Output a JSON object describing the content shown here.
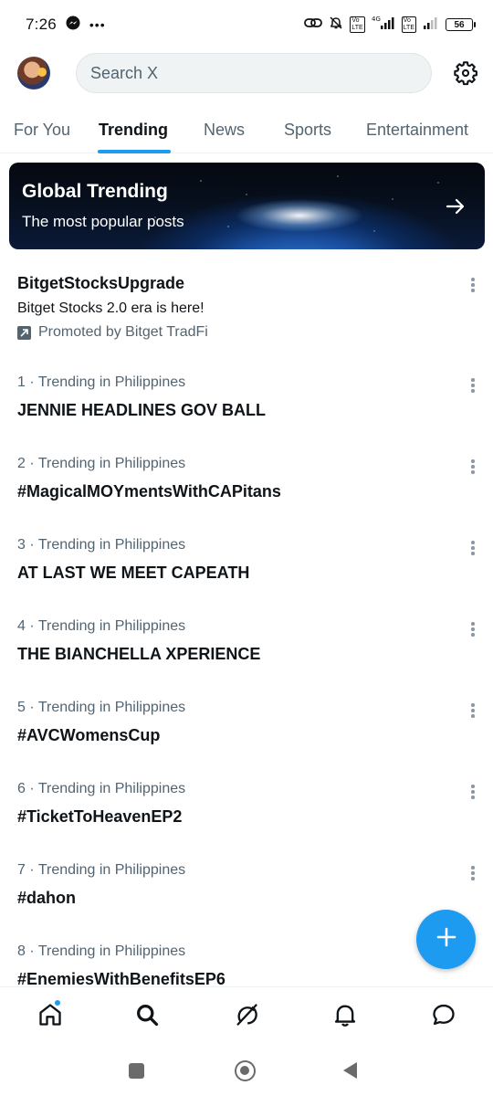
{
  "status_bar": {
    "time": "7:26",
    "battery": "56",
    "network": "4G"
  },
  "search": {
    "placeholder": "Search X"
  },
  "tabs": [
    {
      "label": "For You"
    },
    {
      "label": "Trending"
    },
    {
      "label": "News"
    },
    {
      "label": "Sports"
    },
    {
      "label": "Entertainment"
    }
  ],
  "active_tab": "Trending",
  "banner": {
    "title": "Global Trending",
    "subtitle": "The most popular posts"
  },
  "promoted": {
    "name": "BitgetStocksUpgrade",
    "text": "Bitget Stocks 2.0 era is here!",
    "by": "Promoted by Bitget TradFi"
  },
  "trends": [
    {
      "meta": "1 · Trending in Philippines",
      "title": "JENNIE HEADLINES GOV BALL"
    },
    {
      "meta": "2 · Trending in Philippines",
      "title": "#MagicalMOYmentsWithCAPitans"
    },
    {
      "meta": "3 · Trending in Philippines",
      "title": "AT LAST WE MEET CAPEATH"
    },
    {
      "meta": "4 · Trending in Philippines",
      "title": "THE BIANCHELLA XPERIENCE"
    },
    {
      "meta": "5 · Trending in Philippines",
      "title": "#AVCWomensCup"
    },
    {
      "meta": "6 · Trending in Philippines",
      "title": "#TicketToHeavenEP2"
    },
    {
      "meta": "7 · Trending in Philippines",
      "title": "#dahon"
    },
    {
      "meta": "8 · Trending in Philippines",
      "title": "#EnemiesWithBenefitsEP6"
    }
  ],
  "colors": {
    "accent": "#1d9bf0",
    "text": "#0f1419",
    "secondary": "#536471"
  },
  "icons": [
    "messenger-icon",
    "link-icon",
    "mute-bell-icon",
    "signal-icon",
    "gear-icon",
    "arrow-right-icon",
    "more-icon",
    "promoted-icon",
    "plus-icon",
    "home-icon",
    "search-icon",
    "grok-icon",
    "bell-icon",
    "messages-icon"
  ]
}
